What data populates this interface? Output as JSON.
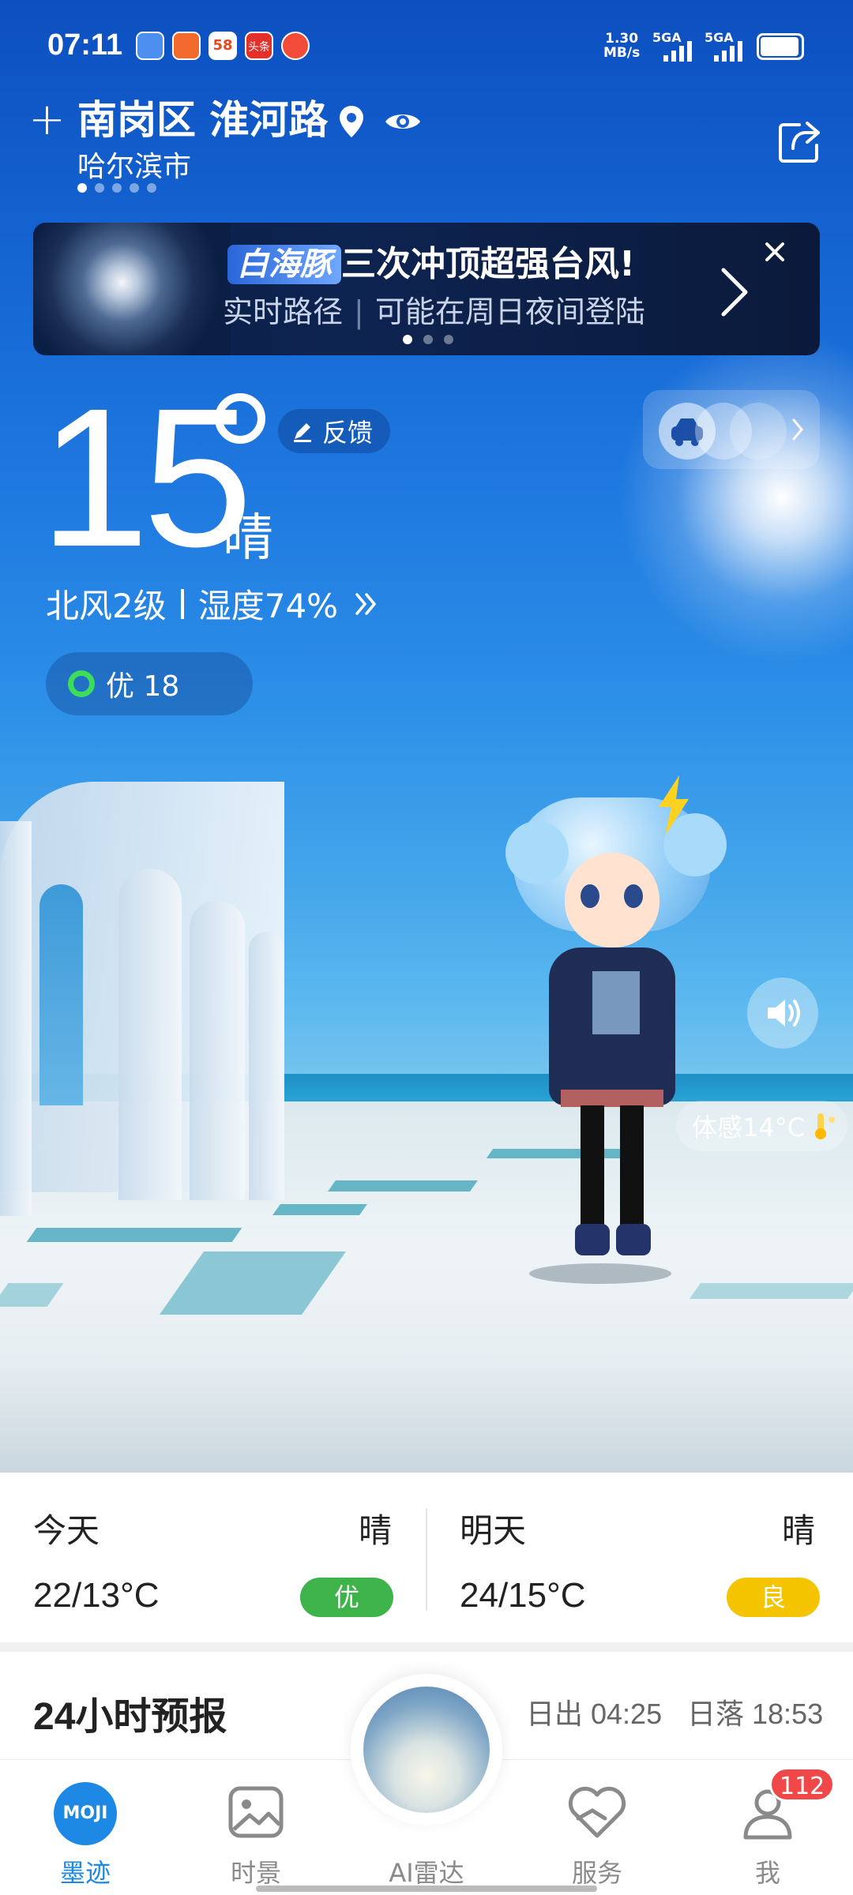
{
  "status_bar": {
    "time": "07:11",
    "speed_value": "1.30",
    "speed_unit": "MB/s",
    "sim1": "5GA",
    "sim2": "5GA",
    "app_icons": [
      "weather-app-icon",
      "app-icon-red",
      "app-58-icon",
      "toutiao-icon",
      "app-icon-mascot"
    ],
    "app_58_text": "58",
    "toutiao_text": "头条"
  },
  "location": {
    "district_road": "南岗区 淮河路",
    "city": "哈尔滨市",
    "page_dots": 5,
    "active_dot": 0
  },
  "banner": {
    "brand": "白海豚",
    "headline": "三次冲顶超强台风!",
    "sub_left": "实时路径",
    "sub_right": "可能在周日夜间登陆",
    "dots": 3,
    "active_dot": 0
  },
  "current": {
    "temperature": "15",
    "degree_symbol": "°",
    "condition": "晴",
    "feedback_label": "反馈",
    "wind": "北风2级",
    "humidity": "湿度74%",
    "aqi_label": "优 18",
    "feels_like": "体感14°C"
  },
  "forecast": {
    "today": {
      "label": "今天",
      "condition": "晴",
      "range": "22/13°C",
      "aqi": "优",
      "aqi_color": "#3db34a"
    },
    "tomorrow": {
      "label": "明天",
      "condition": "晴",
      "range": "24/15°C",
      "aqi": "良",
      "aqi_color": "#f5c400"
    }
  },
  "hourly": {
    "title": "24小时预报",
    "sunrise": "日出 04:25",
    "sunset": "日落 18:53"
  },
  "tabbar": {
    "items": [
      {
        "label": "墨迹",
        "icon": "moji-logo-icon"
      },
      {
        "label": "时景",
        "icon": "photo-icon"
      },
      {
        "label": "AI雷达",
        "icon": "ai-radar-icon"
      },
      {
        "label": "服务",
        "icon": "heart-hand-icon"
      },
      {
        "label": "我",
        "icon": "profile-icon"
      }
    ],
    "moji_logo_text": "MOJI",
    "me_badge": "112"
  },
  "colors": {
    "accent_blue": "#1e88e5",
    "aqi_green": "#3db34a",
    "aqi_yellow": "#f5c400",
    "badge_red": "#f04848"
  }
}
